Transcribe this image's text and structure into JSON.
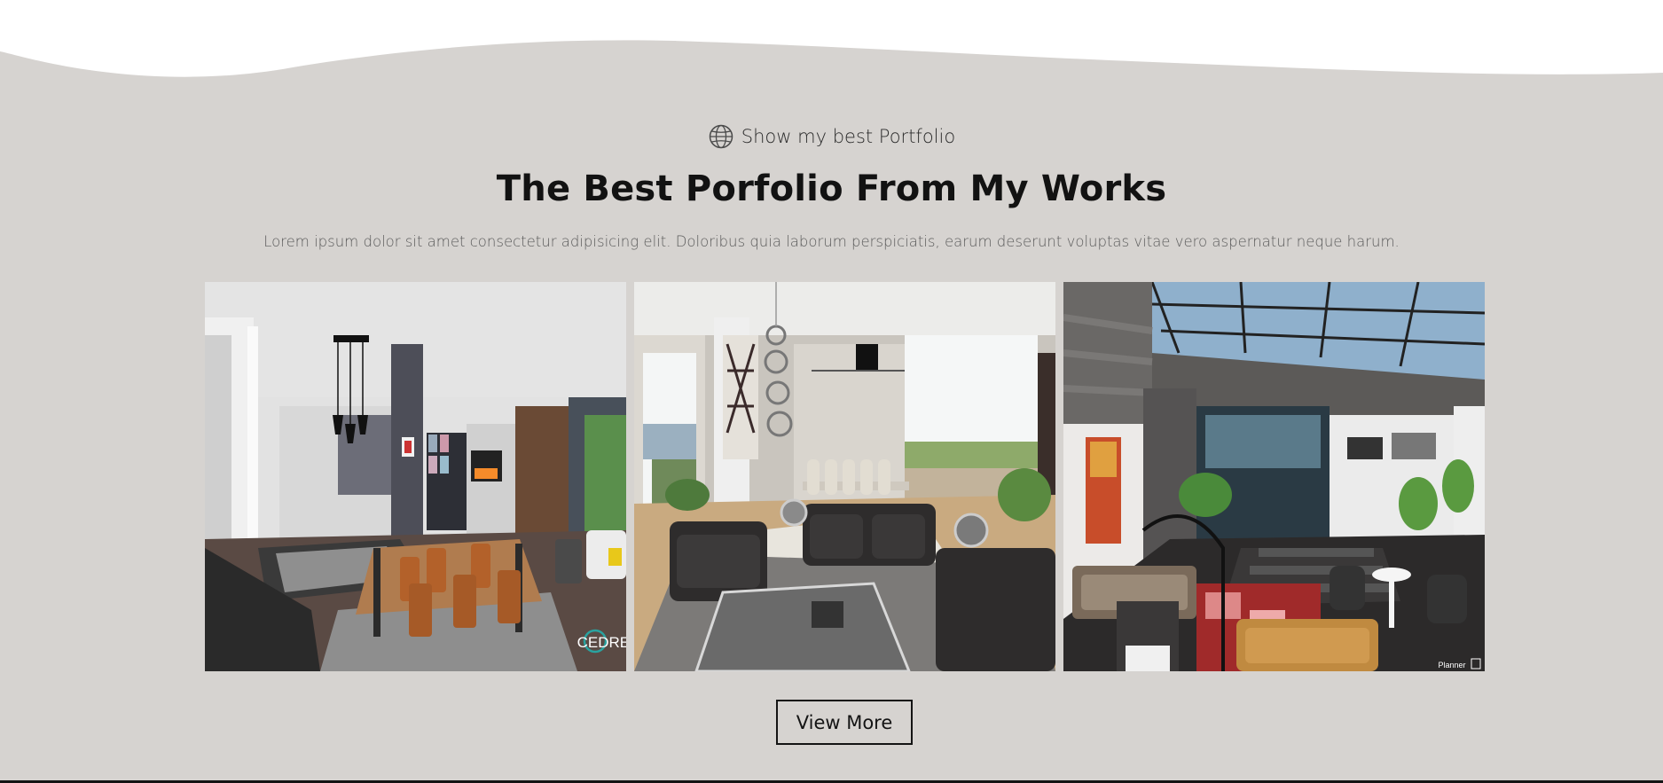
{
  "portfolio": {
    "tagline": "Show my best Portfolio",
    "tagline_icon": "globe-icon",
    "title": "The Best Porfolio From My Works",
    "description": "Lorem ipsum dolor sit amet consectetur adipisicing elit. Doloribus quia laborum perspiciatis, earum deserunt voluptas vitae vero aspernatur neque harum.",
    "items": [
      {
        "watermark": "CEDREO"
      },
      {
        "watermark": ""
      },
      {
        "watermark": "Planner"
      }
    ],
    "view_more_label": "View More"
  },
  "colors": {
    "section_bg": "#d6d3d0",
    "page_bg": "#ffffff",
    "title": "#121212",
    "text": "#5c5c5c",
    "button_border": "#141414"
  }
}
